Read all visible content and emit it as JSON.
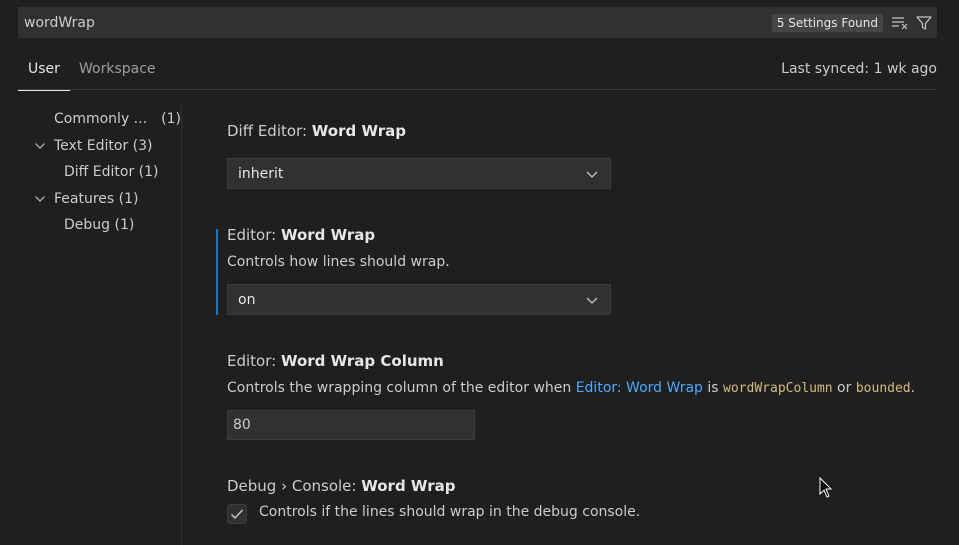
{
  "search": {
    "value": "wordWrap",
    "result_badge": "5 Settings Found",
    "clear_icon": "clear-filter-icon",
    "filter_icon": "filter-icon"
  },
  "tabs": {
    "user": "User",
    "workspace": "Workspace",
    "active": "User",
    "last_synced": "Last synced: 1 wk ago"
  },
  "tree": {
    "items": [
      {
        "label": "Commonly ...",
        "count": "(1)"
      },
      {
        "label": "Text Editor (3)"
      },
      {
        "label": "Diff Editor (1)"
      },
      {
        "label": "Features (1)"
      },
      {
        "label": "Debug (1)"
      }
    ]
  },
  "settings": {
    "diff_word_wrap": {
      "category": "Diff Editor: ",
      "name": "Word Wrap",
      "value": "inherit"
    },
    "editor_word_wrap": {
      "category": "Editor: ",
      "name": "Word Wrap",
      "description": "Controls how lines should wrap.",
      "value": "on"
    },
    "editor_word_wrap_column": {
      "category": "Editor: ",
      "name": "Word Wrap Column",
      "desc_prefix": "Controls the wrapping column of the editor when ",
      "desc_link": "Editor: Word Wrap",
      "desc_is": " is ",
      "desc_code1": "wordWrapColumn",
      "desc_or": " or ",
      "desc_code2": "bounded",
      "desc_end": ".",
      "value": "80"
    },
    "debug_console_word_wrap": {
      "category": "Debug › Console: ",
      "name": "Word Wrap",
      "description": "Controls if the lines should wrap in the debug console.",
      "checked": true
    }
  },
  "colors": {
    "background": "#1f1f1f",
    "input_background": "#313131",
    "link": "#4daafc",
    "code": "#d7ba7d",
    "focus_bar": "#0078d4"
  }
}
